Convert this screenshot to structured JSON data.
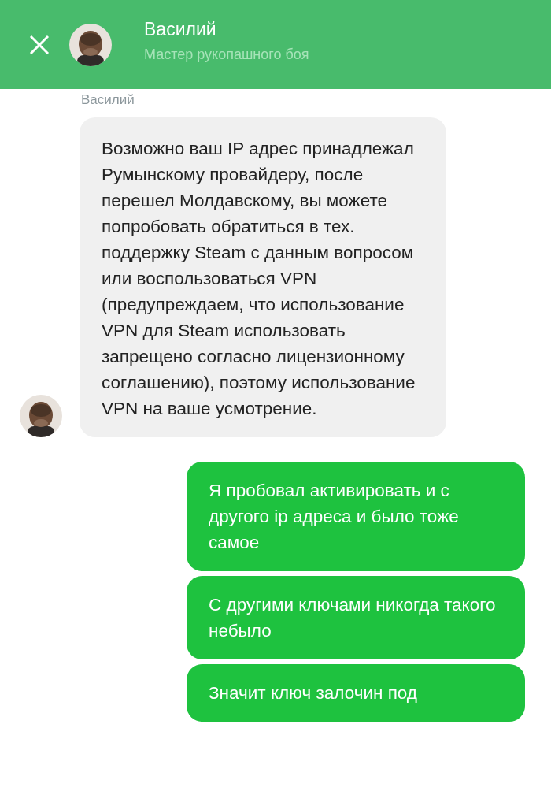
{
  "header": {
    "title": "Василий",
    "subtitle": "Мастер рукопашного боя"
  },
  "messages": [
    {
      "kind": "incoming",
      "sender": "Василий",
      "text": "Возможно ваш IP адрес принадлежал Румынскому провайдеру, после перешел Молдавскому, вы можете попробовать обратиться в тех. поддержку Steam с данным вопросом или воспользоваться VPN (предупреждаем, что использование VPN для Steam использовать запрещено согласно лицензионному соглашению), поэтому использование VPN на ваше усмотрение."
    },
    {
      "kind": "outgoing",
      "text": "Я пробовал активировать и с другого ip адреса и было тоже самое"
    },
    {
      "kind": "outgoing",
      "text": "С другими ключами никогда такого небыло"
    },
    {
      "kind": "outgoing",
      "text": "Значит ключ залочин под"
    }
  ]
}
